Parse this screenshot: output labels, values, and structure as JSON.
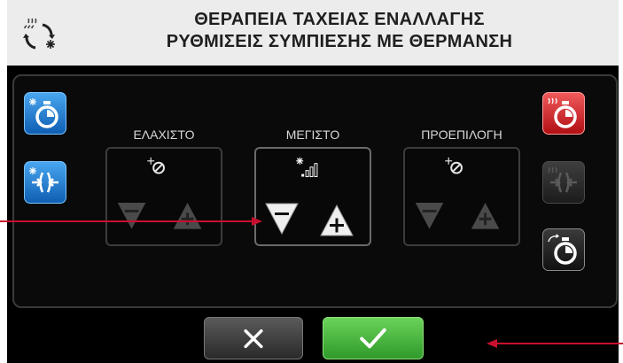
{
  "header": {
    "title_line1": "ΘΕΡΑΠΕΙΑ ΤΑΧΕΙΑΣ ΕΝΑΛΛΑΓΗΣ",
    "title_line2": "ΡΥΘΜΙΣΕΙΣ ΣΥΜΠΙΕΣΗΣ ΜΕ ΘΕΡΜΑΝΣΗ",
    "icon": "cycle-heat-cold-icon"
  },
  "columns": [
    {
      "label": "ΕΛΑΧΙΣΤΟ",
      "icon": "compression-off-icon",
      "enabled": false
    },
    {
      "label": "ΜΕΓΙΣΤΟ",
      "icon": "compression-level-icon",
      "enabled": true
    },
    {
      "label": "ΠΡΟΕΠΙΛΟΓΗ",
      "icon": "compression-off-icon",
      "enabled": false
    }
  ],
  "left_buttons": [
    {
      "icon": "cold-timer-icon",
      "color": "#1c7fd6"
    },
    {
      "icon": "cold-compression-icon",
      "color": "#1c7fd6"
    }
  ],
  "right_buttons": [
    {
      "icon": "heat-timer-icon",
      "color": "#d7262a"
    },
    {
      "icon": "heat-compression-icon",
      "color": "#3a3a3a",
      "enabled": false
    },
    {
      "icon": "cycle-timer-icon",
      "color": "#2b2b2b"
    }
  ],
  "actions": {
    "cancel_icon": "x-icon",
    "confirm_icon": "checkmark-icon"
  },
  "annotations": {
    "arrow_color": "#c8102e"
  }
}
